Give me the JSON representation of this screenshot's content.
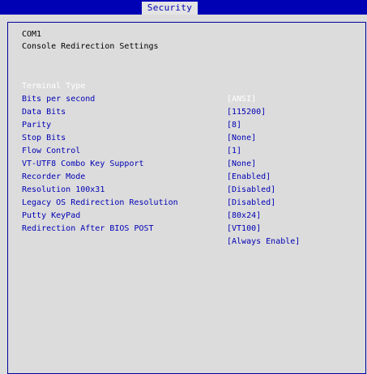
{
  "header": {
    "tab_label": "Security"
  },
  "panel": {
    "port_title": "COM1",
    "section_title": "Console Redirection Settings"
  },
  "settings": [
    {
      "label": "Terminal Type",
      "value": "[ANSI]",
      "selected": true
    },
    {
      "label": "Bits per second",
      "value": "[115200]"
    },
    {
      "label": "Data Bits",
      "value": "[8]"
    },
    {
      "label": "Parity",
      "value": "[None]"
    },
    {
      "label": "Stop Bits",
      "value": "[1]"
    },
    {
      "label": "Flow Control",
      "value": "[None]"
    },
    {
      "label": "VT-UTF8 Combo Key Support",
      "value": "[Enabled]"
    },
    {
      "label": "Recorder Mode",
      "value": "[Disabled]"
    },
    {
      "label": "Resolution 100x31",
      "value": "[Disabled]"
    },
    {
      "label": "Legacy OS Redirection Resolution",
      "value": "[80x24]"
    },
    {
      "label": "Putty KeyPad",
      "value": "[VT100]"
    },
    {
      "label": "Redirection After BIOS POST",
      "value": "[Always Enable]"
    }
  ],
  "colors": {
    "accent": "#0000b4",
    "background": "#dcdcdc",
    "selected_text": "#ffffff"
  }
}
